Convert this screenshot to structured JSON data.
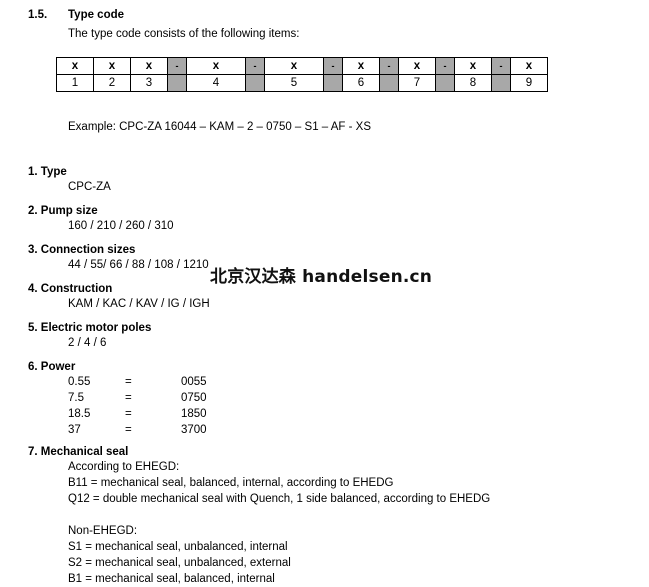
{
  "section": {
    "number": "1.5.",
    "title": "Type code",
    "intro": "The type code consists of the following items:"
  },
  "code_table": {
    "top_row": [
      "x",
      "x",
      "x",
      "-",
      "x",
      "-",
      "x",
      "-",
      "x",
      "-",
      "x",
      "-",
      "x",
      "-",
      "x"
    ],
    "bottom_row": [
      "1",
      "2",
      "3",
      "",
      "4",
      "",
      "5",
      "",
      "6",
      "",
      "7",
      "",
      "8",
      "",
      "9"
    ],
    "separator_color": "#a8a8a8"
  },
  "example": {
    "text": "Example: CPC-ZA 16044 – KAM – 2 – 0750 – S1 – AF - XS"
  },
  "items": [
    {
      "heading": "1. Type",
      "body": "CPC-ZA"
    },
    {
      "heading": "2. Pump size",
      "body": "160 / 210 / 260 / 310"
    },
    {
      "heading": "3. Connection sizes",
      "body": "44 / 55/ 66 / 88 / 108 / 1210"
    },
    {
      "heading": "4. Construction",
      "body": "KAM / KAC / KAV / IG / IGH"
    },
    {
      "heading": "5. Electric motor poles",
      "body": "2 / 4 / 6"
    },
    {
      "heading": "6. Power",
      "body": ""
    },
    {
      "heading": "7. Mechanical seal",
      "body": ""
    }
  ],
  "power_table": {
    "rows": [
      {
        "value": "0.55",
        "eq": "=",
        "code": "0055"
      },
      {
        "value": "7.5",
        "eq": "=",
        "code": "0750"
      },
      {
        "value": "18.5",
        "eq": "=",
        "code": "1850"
      },
      {
        "value": "37",
        "eq": "=",
        "code": "3700"
      }
    ]
  },
  "mechanical_seal": {
    "ehegd_label": "According to EHEGD:",
    "ehegd_lines": [
      "B11 = mechanical seal, balanced, internal, according to EHEDG",
      "Q12 = double mechanical seal with Quench, 1 side balanced, according to EHEDG"
    ],
    "non_ehegd_label": "Non-EHEGD:",
    "non_ehegd_lines": [
      "S1 = mechanical seal, unbalanced, internal",
      "S2 = mechanical seal, unbalanced, external",
      "B1 = mechanical seal, balanced, internal"
    ]
  },
  "watermark": {
    "text": "北京汉达森 handelsen.cn"
  }
}
